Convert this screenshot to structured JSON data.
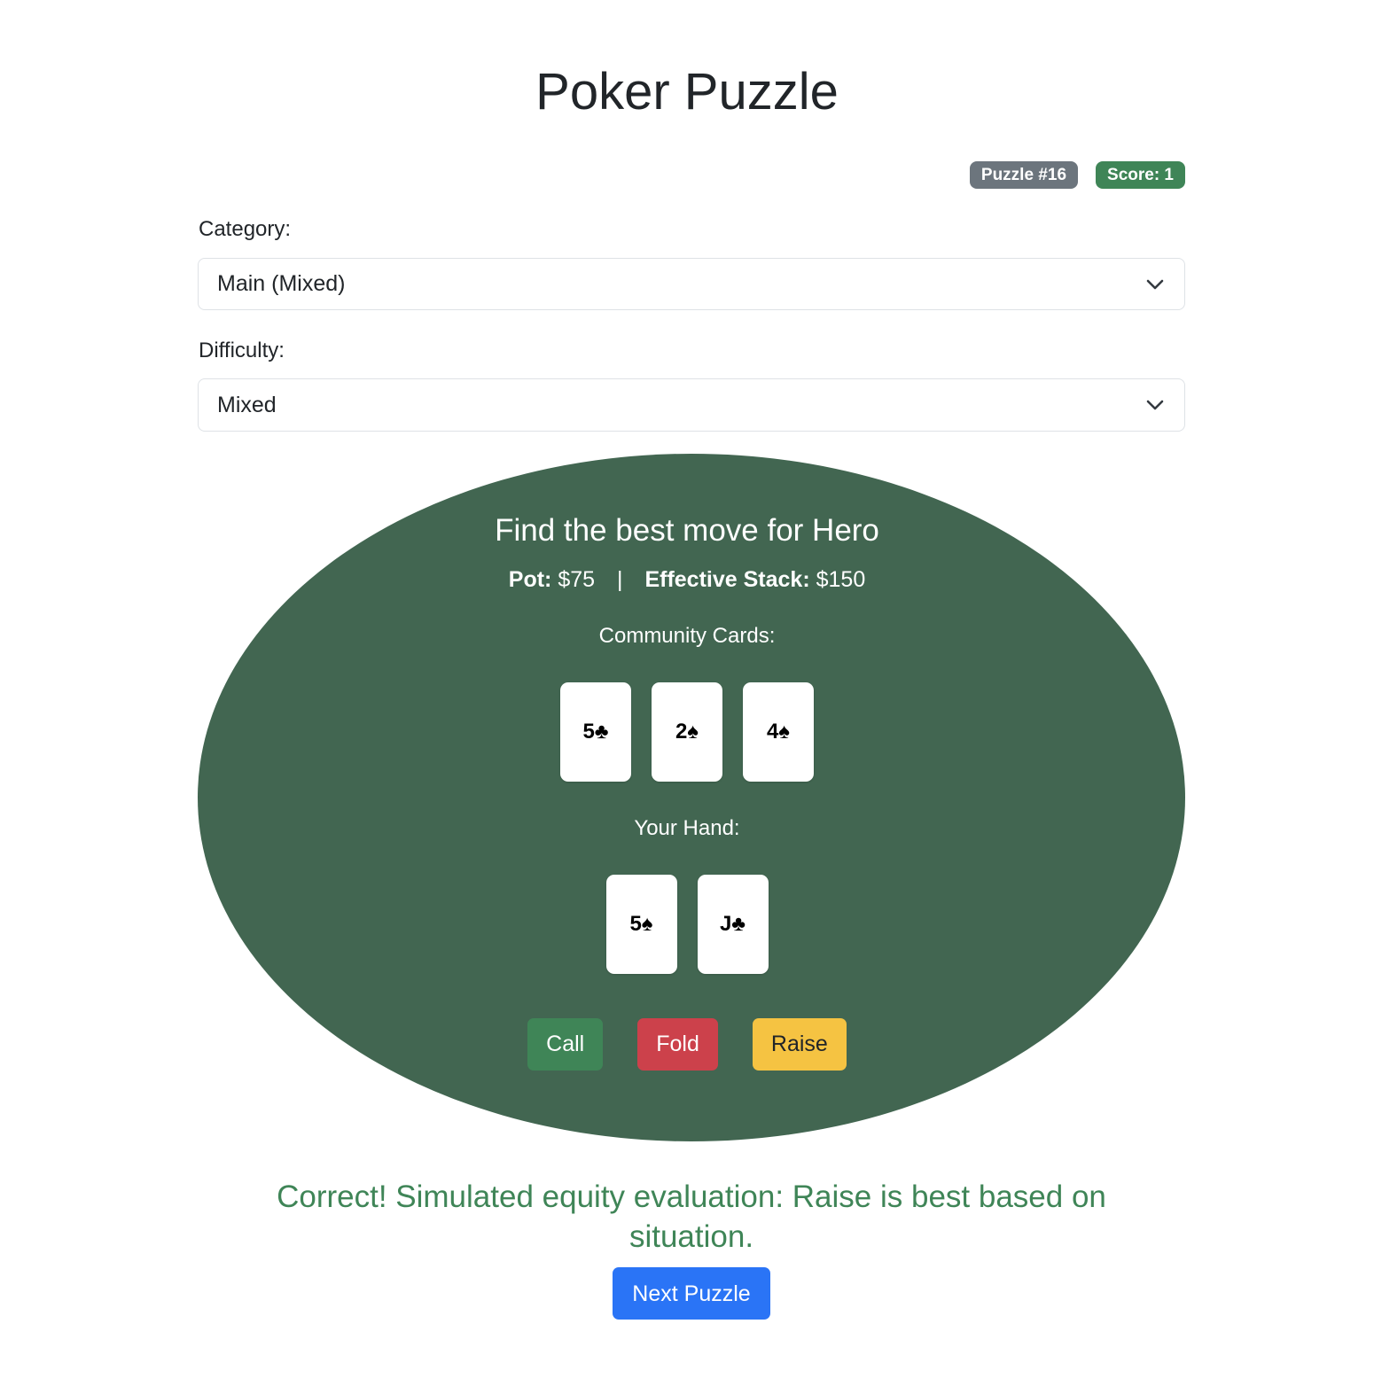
{
  "header": {
    "title": "Poker Puzzle"
  },
  "badges": {
    "puzzle": "Puzzle #16",
    "score": "Score: 1"
  },
  "category": {
    "label": "Category:",
    "selected": "Main (Mixed)"
  },
  "difficulty": {
    "label": "Difficulty:",
    "selected": "Mixed"
  },
  "table": {
    "title": "Find the best move for Hero",
    "pot_label": "Pot:",
    "pot_value": "$75",
    "separator": "|",
    "stack_label": "Effective Stack:",
    "stack_value": "$150",
    "community_label": "Community Cards:",
    "community_cards": [
      "5♣",
      "2♠",
      "4♠"
    ],
    "hand_label": "Your Hand:",
    "hand_cards": [
      "5♠",
      "J♣"
    ]
  },
  "actions": {
    "call": "Call",
    "fold": "Fold",
    "raise": "Raise"
  },
  "result": {
    "message": "Correct! Simulated equity evaluation: Raise is best based on situation."
  },
  "next_button": "Next Puzzle",
  "colors": {
    "table_felt": "#426651",
    "success": "#3f8557",
    "danger": "#cc414b",
    "warning": "#f5c342",
    "primary": "#2a74f6",
    "secondary": "#6c757d"
  }
}
